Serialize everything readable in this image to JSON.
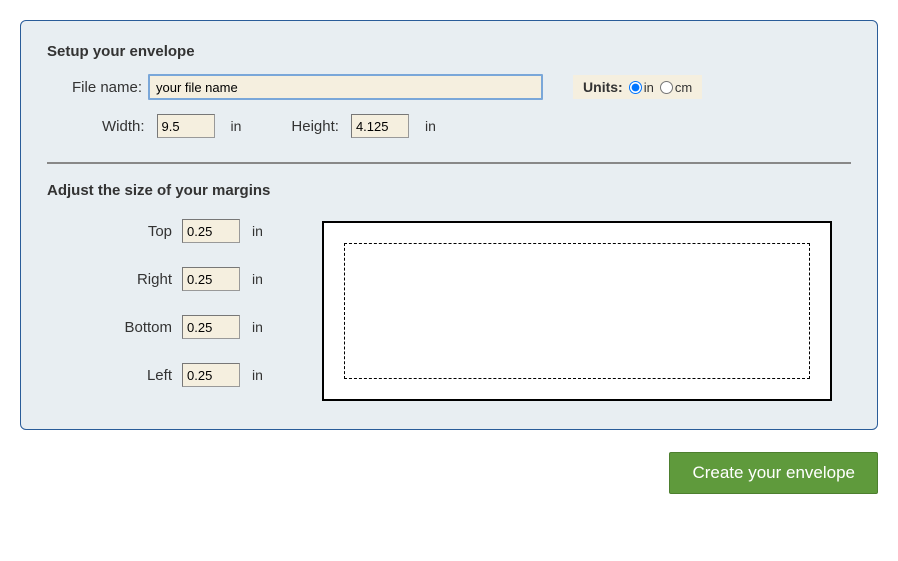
{
  "setup": {
    "heading": "Setup your envelope",
    "filename_label": "File name:",
    "filename_value": "your file name",
    "units_label": "Units:",
    "unit_in": "in",
    "unit_cm": "cm",
    "units_selected": "in",
    "width_label": "Width:",
    "width_value": "9.5",
    "width_unit": "in",
    "height_label": "Height:",
    "height_value": "4.125",
    "height_unit": "in"
  },
  "margins": {
    "heading": "Adjust the size of your margins",
    "top_label": "Top",
    "top_value": "0.25",
    "top_unit": "in",
    "right_label": "Right",
    "right_value": "0.25",
    "right_unit": "in",
    "bottom_label": "Bottom",
    "bottom_value": "0.25",
    "bottom_unit": "in",
    "left_label": "Left",
    "left_value": "0.25",
    "left_unit": "in"
  },
  "submit": {
    "label": "Create your envelope"
  }
}
